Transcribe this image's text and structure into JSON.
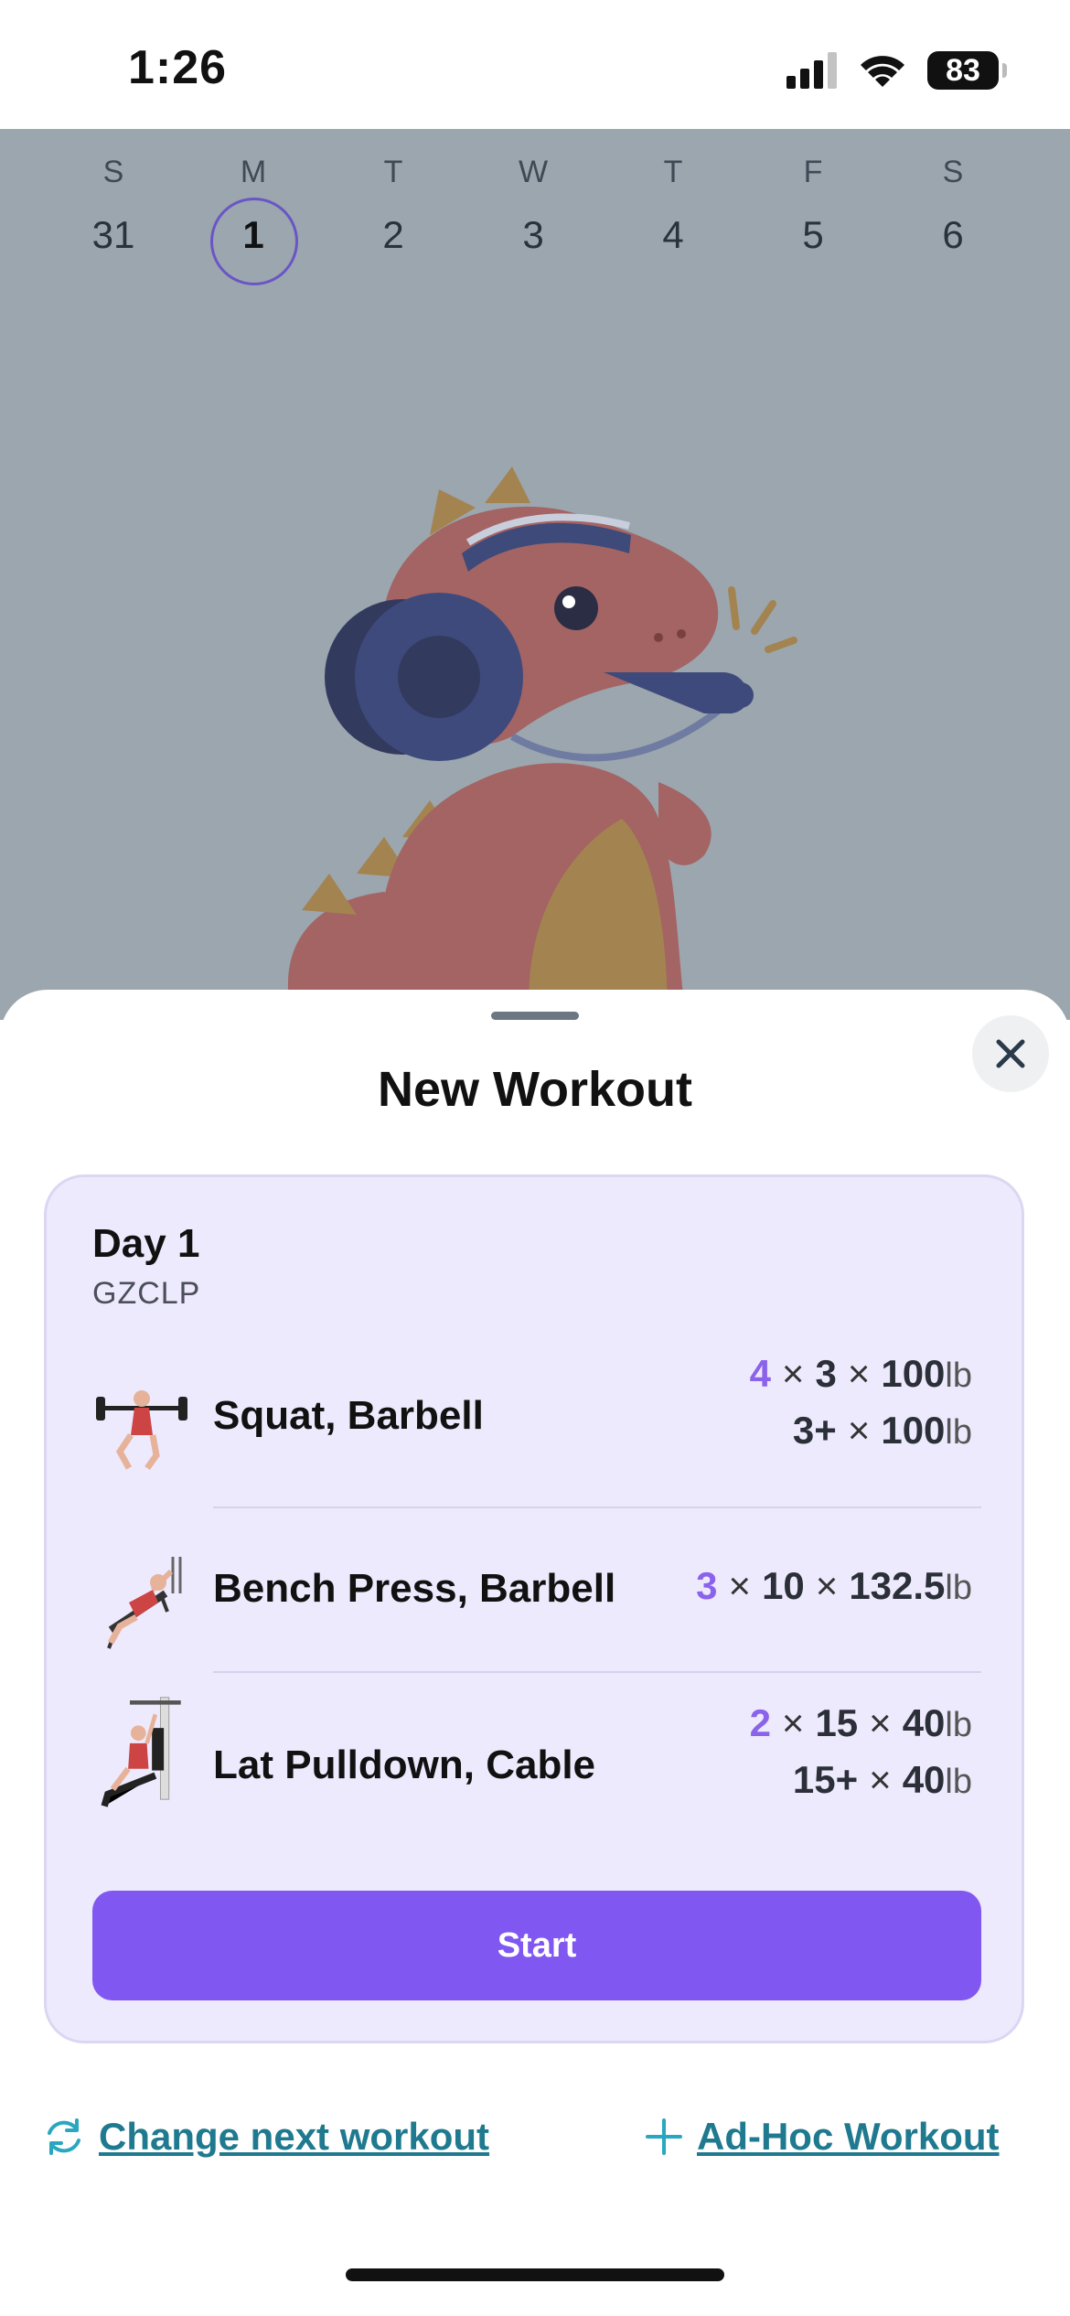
{
  "status": {
    "time": "1:26",
    "battery": "83"
  },
  "calendar": {
    "days": [
      {
        "letter": "S",
        "num": "31"
      },
      {
        "letter": "M",
        "num": "1",
        "selected": true
      },
      {
        "letter": "T",
        "num": "2"
      },
      {
        "letter": "W",
        "num": "3"
      },
      {
        "letter": "T",
        "num": "4"
      },
      {
        "letter": "F",
        "num": "5"
      },
      {
        "letter": "S",
        "num": "6"
      }
    ]
  },
  "sheet": {
    "title": "New Workout",
    "card": {
      "day": "Day 1",
      "program": "GZCLP",
      "exercises": [
        {
          "name": "Squat, Barbell",
          "sets": [
            {
              "count": "4",
              "reps": "3",
              "weight": "100",
              "unit": "lb"
            },
            {
              "count": "",
              "reps": "3+",
              "weight": "100",
              "unit": "lb"
            }
          ]
        },
        {
          "name": "Bench Press, Barbell",
          "sets": [
            {
              "count": "3",
              "reps": "10",
              "weight": "132.5",
              "unit": "lb"
            }
          ]
        },
        {
          "name": "Lat Pulldown, Cable",
          "sets": [
            {
              "count": "2",
              "reps": "15",
              "weight": "40",
              "unit": "lb"
            },
            {
              "count": "",
              "reps": "15+",
              "weight": "40",
              "unit": "lb"
            }
          ]
        }
      ],
      "start_label": "Start"
    },
    "links": {
      "change": "Change next workout",
      "adhoc": "Ad-Hoc Workout"
    }
  },
  "colors": {
    "accent": "#8057f0",
    "accent_text": "#8a63ea",
    "link": "#1f7a8f",
    "card_bg": "#eeeafd",
    "overlay": "#9ba6ae"
  },
  "icons": {
    "close": "close-icon",
    "refresh": "refresh-icon",
    "plus": "plus-icon"
  }
}
